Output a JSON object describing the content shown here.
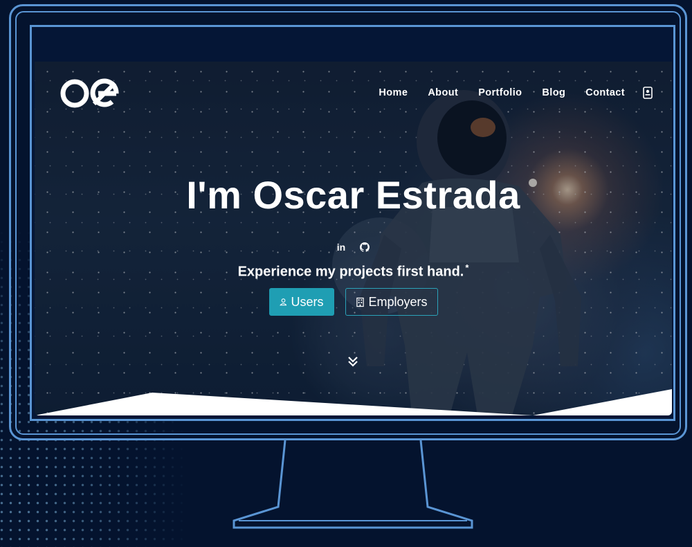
{
  "site": {
    "logo_text": "oe",
    "nav": {
      "items": [
        "Home",
        "About",
        "Portfolio",
        "Blog",
        "Contact"
      ],
      "icon": "contact-card-icon"
    },
    "hero": {
      "title": "I'm Oscar Estrada",
      "social": [
        {
          "label": "in",
          "icon": "linkedin-icon"
        },
        {
          "label": "",
          "icon": "github-icon"
        }
      ],
      "tagline": "Experience my projects first hand.",
      "tagline_mark": "*",
      "buttons": {
        "users": {
          "label": "Users",
          "icon": "user-icon"
        },
        "employers": {
          "label": "Employers",
          "icon": "building-icon"
        }
      },
      "scroll_icon": "double-chevron-down-icon"
    }
  },
  "colors": {
    "background": "#04132e",
    "frame": "#5a95d4",
    "primary_button": "#1f9eb3",
    "text": "#ffffff"
  }
}
